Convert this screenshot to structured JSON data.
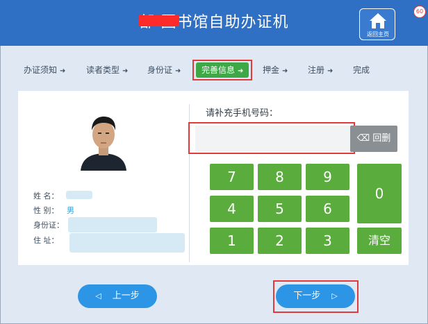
{
  "header": {
    "title": "部 图书馆自助办证机",
    "home_label": "返回主页",
    "badge": "60",
    "home_icon": "home-icon"
  },
  "steps": [
    {
      "label": "办证须知",
      "arrow": "➜",
      "active": false
    },
    {
      "label": "读者类型",
      "arrow": "➜",
      "active": false
    },
    {
      "label": "身份证",
      "arrow": "➜",
      "active": false
    },
    {
      "label": "完善信息",
      "arrow": "➜",
      "active": true
    },
    {
      "label": "押金",
      "arrow": "➜",
      "active": false
    },
    {
      "label": "注册",
      "arrow": "➜",
      "active": false
    },
    {
      "label": "完成",
      "arrow": "",
      "active": false
    }
  ],
  "person": {
    "name_label": "姓 名：",
    "name_value": "",
    "gender_label": "性 别：",
    "gender_value": "男",
    "id_label": "身份证：",
    "id_value": "",
    "address_label": "住 址：",
    "address_value": ""
  },
  "phone": {
    "label": "请补充手机号码：",
    "value": "",
    "backspace_label": "⌫ 回删"
  },
  "keypad": {
    "k7": "7",
    "k8": "8",
    "k9": "9",
    "k4": "4",
    "k5": "5",
    "k6": "6",
    "k1": "1",
    "k2": "2",
    "k3": "3",
    "k0": "0",
    "clear": "清空"
  },
  "nav": {
    "prev_label": "上一步",
    "prev_arrow": "◁",
    "next_label": "下一步",
    "next_arrow": "▷"
  },
  "colors": {
    "header_bg": "#2f6fc4",
    "key_green": "#5aac3d",
    "active_step": "#3da845",
    "nav_blue": "#2d95e6",
    "highlight_red": "#e23a3a"
  }
}
